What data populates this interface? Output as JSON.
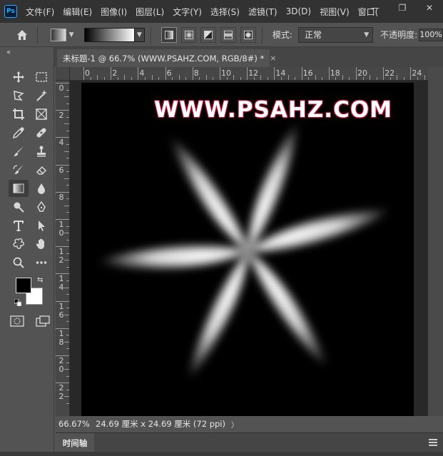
{
  "app": {
    "logo_text": "Ps",
    "menu": [
      "文件(F)",
      "编辑(E)",
      "图像(I)",
      "图层(L)",
      "文字(Y)",
      "选择(S)",
      "滤镜(T)",
      "3D(D)",
      "视图(V)",
      "窗口("
    ]
  },
  "window_controls": {
    "minimize": "—",
    "restore": "❐",
    "close": "✕"
  },
  "options": {
    "mode_label": "模式:",
    "mode_value": "正常",
    "opacity_label": "不透明度:",
    "opacity_value": "100%"
  },
  "toolbar": {
    "collapse": "«"
  },
  "document": {
    "tab_title": "未标题-1 @ 66.7% (WWW.PSAHZ.COM, RGB/8#) *",
    "tab_close": "×",
    "watermark": "WWW.PSAHZ.COM"
  },
  "rulers": {
    "top_labels": [
      "0",
      "2",
      "4",
      "6",
      "8",
      "10",
      "12",
      "14",
      "16",
      "18",
      "20",
      "22",
      "24"
    ],
    "left_labels": [
      "0",
      "2",
      "4",
      "6",
      "8",
      "10",
      "12",
      "14",
      "16",
      "18",
      "20",
      "22"
    ]
  },
  "status": {
    "zoom": "66.67%",
    "doc_info": "24.69 厘米 x 24.69 厘米 (72 ppi)",
    "arrow": "〉"
  },
  "panel": {
    "timeline_label": "时间轴"
  },
  "colors": {
    "foreground": "#000000",
    "background": "#ffffff",
    "watermark_outline": "#c0103a"
  }
}
